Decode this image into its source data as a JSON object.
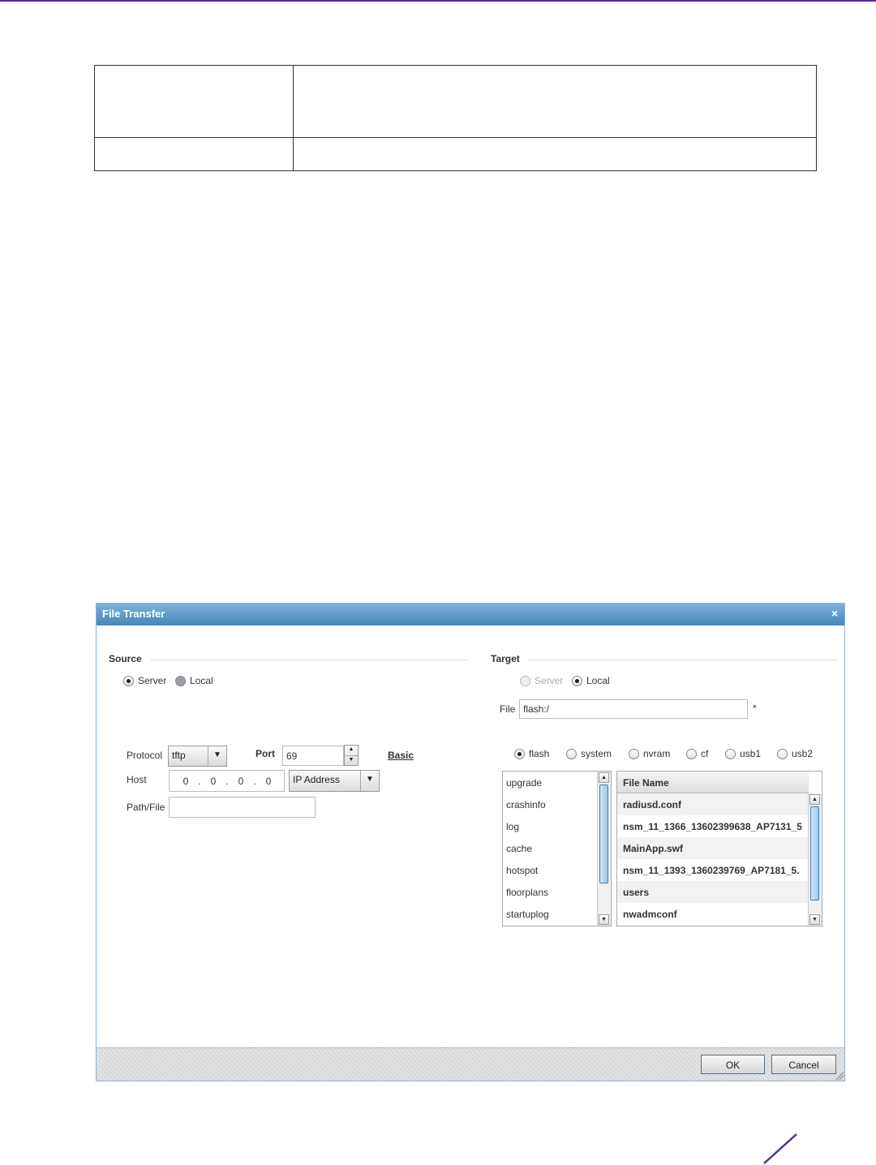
{
  "dialog": {
    "title": "File Transfer",
    "close_label": "×",
    "source": {
      "section_label": "Source",
      "radio_server": "Server",
      "radio_local": "Local",
      "protocol_label": "Protocol",
      "protocol_value": "tftp",
      "port_label": "Port",
      "port_value": "69",
      "basic_link": "Basic",
      "host_label": "Host",
      "host_octets": [
        "0",
        "0",
        "0",
        "0"
      ],
      "host_type_value": "IP Address",
      "pathfile_label": "Path/File",
      "pathfile_value": ""
    },
    "target": {
      "section_label": "Target",
      "radio_server": "Server",
      "radio_local": "Local",
      "file_label": "File",
      "file_value": "flash:/",
      "required_mark": "*",
      "storage_options": [
        "flash",
        "system",
        "nvram",
        "cf",
        "usb1",
        "usb2"
      ],
      "selected_storage": "flash",
      "folders": [
        "upgrade",
        "crashinfo",
        "log",
        "cache",
        "hotspot",
        "floorplans",
        "startuplog"
      ],
      "file_column_header": "File Name",
      "files": [
        "radiusd.conf",
        "nsm_11_1366_1360239963​8_AP7131_5",
        "MainApp.swf",
        "nsm_11_1393_1360239769_AP7181_5.",
        "users",
        "nwadmconf"
      ]
    },
    "footer": {
      "ok_label": "OK",
      "cancel_label": "Cancel"
    }
  },
  "colors": {
    "accent_purple": "#5b2c8a",
    "titlebar_blue": "#5a96c6"
  }
}
